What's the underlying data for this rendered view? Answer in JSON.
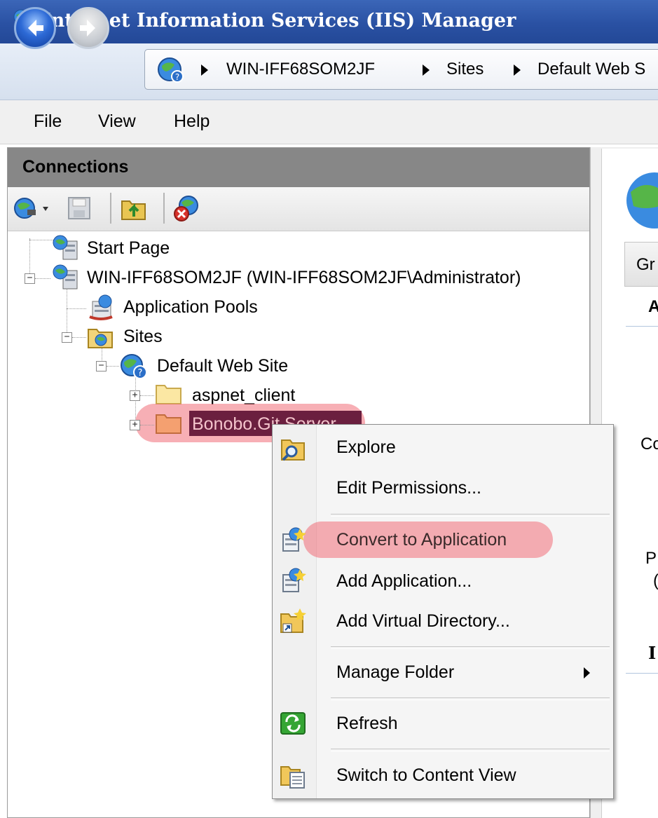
{
  "window": {
    "title": "Internet Information Services (IIS) Manager"
  },
  "address_bar": {
    "crumbs": [
      "WIN-IFF68SOM2JF",
      "Sites",
      "Default Web S"
    ]
  },
  "menubar": {
    "items": [
      "File",
      "View",
      "Help"
    ]
  },
  "connections": {
    "title": "Connections",
    "tree": {
      "start_page": "Start Page",
      "server": "WIN-IFF68SOM2JF (WIN-IFF68SOM2JF\\Administrator)",
      "app_pools": "Application Pools",
      "sites": "Sites",
      "default_site": "Default Web Site",
      "aspnet_client": "aspnet_client",
      "bonobo": "Bonobo.Git.Server"
    }
  },
  "right_pane": {
    "tab_fragment": "Gr",
    "fragments": [
      "A",
      "Co",
      "P",
      "(",
      "I"
    ]
  },
  "context_menu": {
    "items": {
      "explore": "Explore",
      "edit_permissions": "Edit Permissions...",
      "convert": "Convert to Application",
      "add_application": "Add Application...",
      "add_virtual_directory": "Add Virtual Directory...",
      "manage_folder": "Manage Folder",
      "refresh": "Refresh",
      "switch_content_view": "Switch to Content View"
    }
  },
  "highlight_color": "#f06e78",
  "selection_color": "#6b1f3f"
}
